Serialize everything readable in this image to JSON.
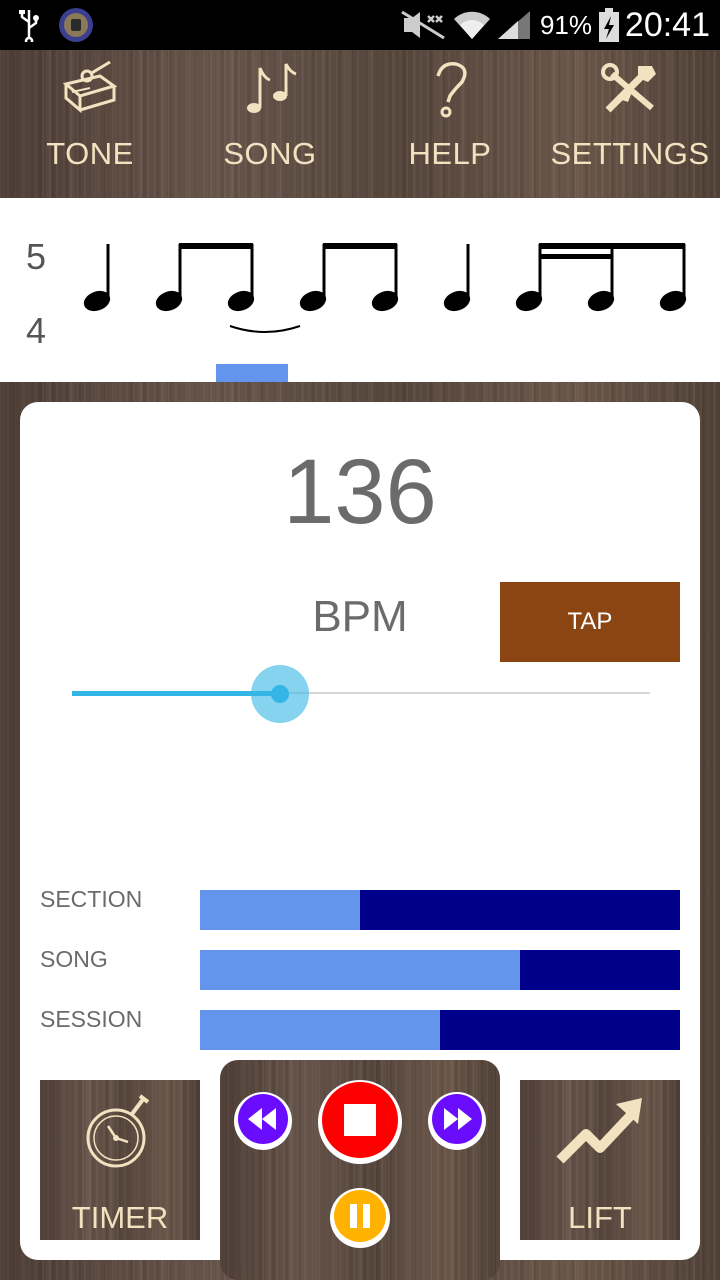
{
  "status_bar": {
    "battery_pct": "91%",
    "time": "20:41",
    "icons": [
      "usb-icon",
      "app-notification-icon",
      "mute-icon",
      "wifi-icon",
      "signal-icon",
      "battery-charging-icon"
    ]
  },
  "nav": {
    "items": [
      {
        "label": "TONE",
        "icon": "woodblock-icon"
      },
      {
        "label": "SONG",
        "icon": "music-notes-icon"
      },
      {
        "label": "HELP",
        "icon": "question-icon"
      },
      {
        "label": "SETTINGS",
        "icon": "tools-icon"
      }
    ]
  },
  "notation": {
    "time_signature": {
      "top": "5",
      "bottom": "4"
    },
    "current_beat": 2
  },
  "metronome": {
    "bpm": "136",
    "bpm_label": "BPM",
    "tap_label": "TAP",
    "slider_fraction": 0.36
  },
  "progress": [
    {
      "label": "SECTION",
      "fraction": 0.333
    },
    {
      "label": "SONG",
      "fraction": 0.667
    },
    {
      "label": "SESSION",
      "fraction": 0.5
    }
  ],
  "tiles": {
    "timer_label": "TIMER",
    "lift_label": "LIFT"
  },
  "transport": {
    "icons": [
      "rewind-icon",
      "stop-icon",
      "fast-forward-icon",
      "pause-icon"
    ]
  },
  "colors": {
    "tap_button": "#8b4513",
    "progress_fill": "#6495ed",
    "progress_track": "#00008b",
    "slider_accent": "#33b5e5",
    "label_cream": "#f2e2bf",
    "stop_red": "#ff0000",
    "skip_purple": "#6a0dff",
    "pause_amber": "#ffb300"
  }
}
